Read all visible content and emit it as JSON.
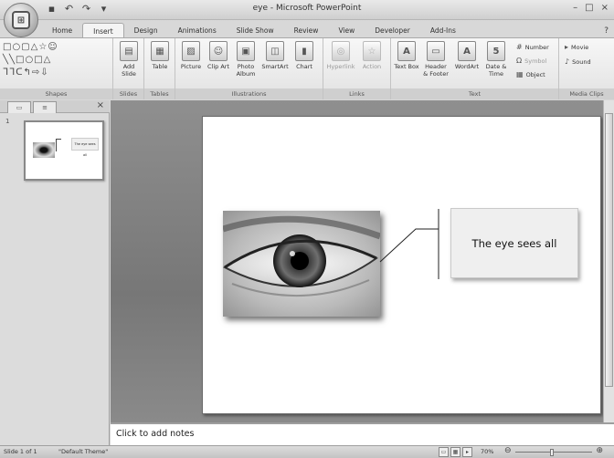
{
  "window": {
    "title": "eye - Microsoft PowerPoint",
    "office_button_label": "Office",
    "qat_icons": [
      "save-icon",
      "undo-icon",
      "redo-icon",
      "customize-icon"
    ],
    "controls": [
      "–",
      "□",
      "×"
    ]
  },
  "tabs": [
    "Home",
    "Insert",
    "Design",
    "Animations",
    "Slide Show",
    "Review",
    "View",
    "Developer",
    "Add-Ins"
  ],
  "active_tab": "Insert",
  "help": "?",
  "ribbon": {
    "shapes": {
      "rows": [
        "□○▢△☆☺",
        "╲╲□○□△",
        "ᒣᒣᑕ↰⇨⇩"
      ],
      "label": "Shapes"
    },
    "slides": {
      "new_slide": "Add Slide",
      "label": "Slides"
    },
    "tables": {
      "table": "Table",
      "label": "Tables"
    },
    "illustrations": {
      "picture": "Picture",
      "clip_art": "Clip Art",
      "photo_album": "Photo Album",
      "smartart": "SmartArt",
      "chart": "Chart",
      "label": "Illustrations"
    },
    "links": {
      "hyperlink": "Hyperlink",
      "action": "Action",
      "label": "Links"
    },
    "text": {
      "text_box": "Text Box",
      "header_footer": "Header & Footer",
      "wordart": "WordArt",
      "date_time": "Date & Time",
      "slide_number": "Number",
      "symbol": "Symbol",
      "object": "Object",
      "label": "Text"
    },
    "media_clips": {
      "movie": "Movie",
      "sound": "Sound",
      "label": "Media Clips"
    }
  },
  "panel": {
    "slide_number": "1",
    "thumbnail_text": "The eye sees all",
    "close": "×"
  },
  "slide": {
    "callout_text": "The eye sees all"
  },
  "notes": {
    "placeholder": "Click to add notes"
  },
  "status": {
    "slide_info": "Slide 1 of 1",
    "theme": "\"Default Theme\"",
    "zoom": "70%"
  }
}
